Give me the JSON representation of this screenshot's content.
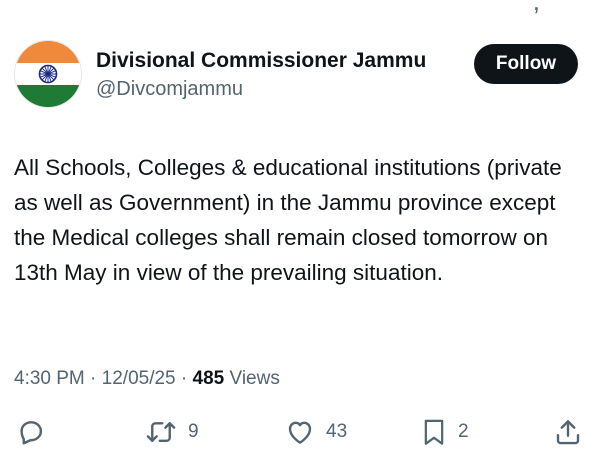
{
  "post": {
    "author": {
      "display_name": "Divisional Commissioner Jammu",
      "handle": "@Divcomjammu",
      "avatar_icon": "india-flag-avatar"
    },
    "follow_label": "Follow",
    "text": "All Schools, Colleges & educational institutions (private as well as Government) in the Jammu province except the Medical colleges shall remain closed tomorrow on 13th May in view of the prevailing situation.",
    "time": "4:30 PM",
    "date": "12/05/25",
    "separator": "·",
    "views_count": "485",
    "views_label": "Views"
  },
  "actions": {
    "reply": {
      "icon": "reply-icon",
      "count": ""
    },
    "repost": {
      "icon": "repost-icon",
      "count": "9"
    },
    "like": {
      "icon": "heart-icon",
      "count": "43"
    },
    "bookmark": {
      "icon": "bookmark-icon",
      "count": "2"
    },
    "share": {
      "icon": "share-icon",
      "count": ""
    }
  },
  "colors": {
    "text_primary": "#0f1419",
    "text_secondary": "#536471",
    "follow_bg": "#0f1419",
    "follow_text": "#ffffff"
  }
}
